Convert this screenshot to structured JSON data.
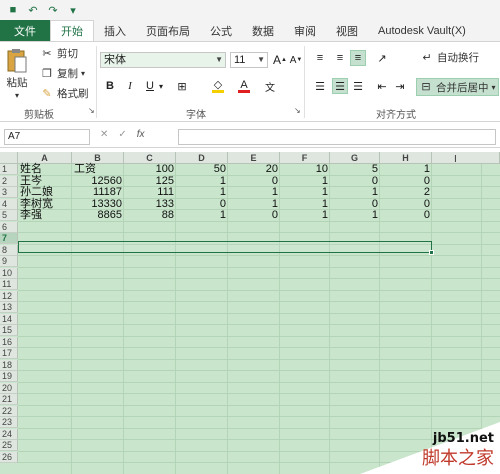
{
  "titlebar": {
    "icons": [
      "save-icon",
      "undo-icon",
      "redo-icon",
      "customize-icon"
    ],
    "glyphs": {
      "save": "■",
      "undo": "↶",
      "redo": "↷",
      "customize": "▾"
    }
  },
  "tabs": [
    {
      "label": "文件",
      "kind": "file"
    },
    {
      "label": "开始",
      "kind": "active"
    },
    {
      "label": "插入",
      "kind": ""
    },
    {
      "label": "页面布局",
      "kind": ""
    },
    {
      "label": "公式",
      "kind": ""
    },
    {
      "label": "数据",
      "kind": ""
    },
    {
      "label": "审阅",
      "kind": ""
    },
    {
      "label": "视图",
      "kind": ""
    },
    {
      "label": "Autodesk Vault(X)",
      "kind": ""
    }
  ],
  "ribbon": {
    "clipboard": {
      "paste_label": "粘贴",
      "paste_arrow": "▾",
      "cut_label": "剪切",
      "copy_label": "复制",
      "copy_arrow": "▾",
      "format_painter_label": "格式刷",
      "group_label": "剪贴板",
      "launcher": "↘"
    },
    "font": {
      "font_name": "宋体",
      "font_size": "11",
      "grow_glyph": "A",
      "shrink_glyph": "A",
      "bold": "B",
      "italic": "I",
      "underline": "U",
      "underline_arrow": "▾",
      "border_glyph": "⊞",
      "fill_glyph": "◇",
      "font_color_glyph": "A",
      "phonetic_glyph": "文",
      "group_label": "字体",
      "launcher": "↘"
    },
    "alignment": {
      "wrap_text_label": "自动换行",
      "merge_center_label": "合并后居中",
      "merge_arrow": "▾",
      "group_label": "对齐方式"
    },
    "colors": {
      "accent": "#217346",
      "fill_icon": "#f5d000",
      "font_icon": "#e02020"
    }
  },
  "formula_bar": {
    "name_box": "A7",
    "cancel_glyph": "✕",
    "enter_glyph": "✓",
    "fx_glyph": "fx",
    "value": ""
  },
  "sheet": {
    "columns": [
      "A",
      "B",
      "C",
      "D",
      "E",
      "F",
      "G",
      "H"
    ],
    "extra_cursor": "I",
    "row_numbers": [
      "1",
      "2",
      "3",
      "4",
      "5",
      "6",
      "7",
      "8",
      "9",
      "10",
      "11",
      "12",
      "13",
      "14",
      "15",
      "16",
      "17",
      "18",
      "19",
      "20",
      "21",
      "22",
      "23",
      "24",
      "25",
      "26"
    ],
    "selected_row": "7",
    "rows": [
      [
        "姓名",
        "工资",
        "100",
        "50",
        "20",
        "10",
        "5",
        "1"
      ],
      [
        "王岑",
        "12560",
        "125",
        "1",
        "0",
        "1",
        "0",
        "0"
      ],
      [
        "孙二娘",
        "11187",
        "111",
        "1",
        "1",
        "1",
        "1",
        "2"
      ],
      [
        "李树宽",
        "13330",
        "133",
        "0",
        "1",
        "1",
        "0",
        "0"
      ],
      [
        "李强",
        "8865",
        "88",
        "1",
        "0",
        "1",
        "1",
        "0"
      ]
    ]
  },
  "watermark": {
    "url": "jb51.net",
    "text": "脚本之家"
  }
}
